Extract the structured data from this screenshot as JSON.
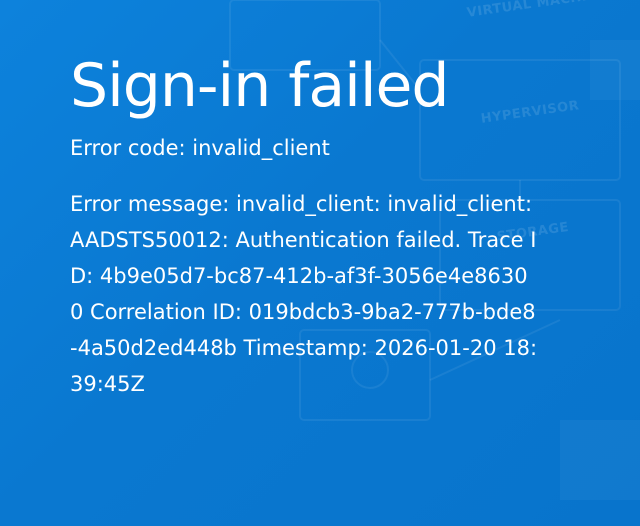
{
  "background": {
    "accent_color": "#0a78d0",
    "labels": {
      "virtual_machines": "VIRTUAL MACHINES",
      "hypervisor": "HYPERVISOR",
      "storage": "STORAGE"
    }
  },
  "page": {
    "title": "Sign-in failed",
    "error_code": "Error code: invalid_client",
    "error_message": "Error message: invalid_client: invalid_client: AADSTS50012: Authentication failed. Trace ID: 4b9e05d7-bc87-412b-af3f-3056e4e86300 Correlation ID: 019bdcb3-9ba2-777b-bde8-4a50d2ed448b Timestamp: 2026-01-20 18:39:45Z"
  }
}
